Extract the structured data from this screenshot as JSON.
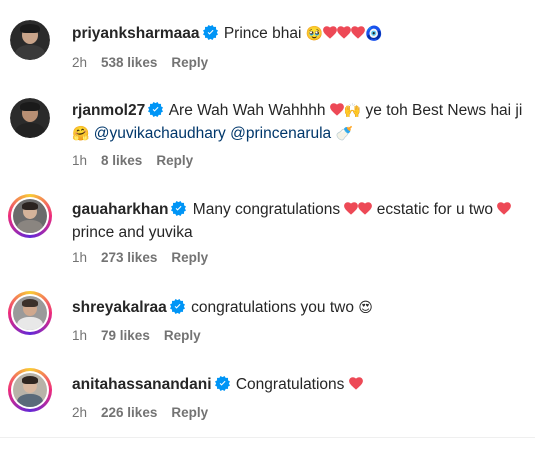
{
  "comments": [
    {
      "username": "priyanksharmaaa",
      "text_before": "Prince bhai ",
      "time": "2h",
      "likes": "538 likes",
      "reply": "Reply"
    },
    {
      "username": "rjanmol27",
      "text_before": "Are Wah Wah Wahhhh ",
      "text_after": " ye toh Best News hai ji ",
      "mention_1": "@yuvikachaudhary",
      "mention_2": "@princenarula",
      "time": "1h",
      "likes": "8 likes",
      "reply": "Reply"
    },
    {
      "username": "gauaharkhan",
      "text_before": "Many congratulations ",
      "text_mid": " ecstatic for u two ",
      "text_after": " prince and yuvika",
      "time": "1h",
      "likes": "273 likes",
      "reply": "Reply"
    },
    {
      "username": "shreyakalraa",
      "text_before": "congratulations you two ",
      "time": "1h",
      "likes": "79 likes",
      "reply": "Reply"
    },
    {
      "username": "anitahassanandani",
      "text_before": "Congratulations ",
      "time": "2h",
      "likes": "226 likes",
      "reply": "Reply"
    }
  ],
  "colors": {
    "verified": "#0095f6",
    "heart": "#ed4956",
    "meta_text": "#737373",
    "mention": "#00376b"
  },
  "icons": [
    "verified-badge-icon",
    "red-heart-icon",
    "sad-face-icon",
    "evil-eye-icon",
    "raising-hands-icon",
    "smiling-face-icon",
    "baby-bottle-icon",
    "heart-eyes-face-icon"
  ]
}
